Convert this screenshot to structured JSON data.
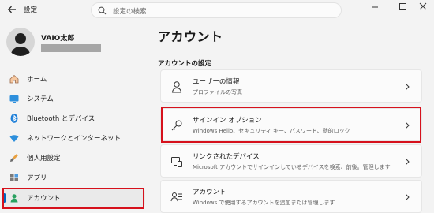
{
  "window": {
    "app_title": "設定",
    "search_placeholder": "設定の検索"
  },
  "user": {
    "name": "VAIO太郎"
  },
  "sidebar": {
    "items": [
      {
        "label": "ホーム",
        "icon": "home-icon"
      },
      {
        "label": "システム",
        "icon": "system-icon"
      },
      {
        "label": "Bluetooth とデバイス",
        "icon": "bluetooth-icon"
      },
      {
        "label": "ネットワークとインターネット",
        "icon": "wifi-icon"
      },
      {
        "label": "個人用設定",
        "icon": "brush-icon"
      },
      {
        "label": "アプリ",
        "icon": "apps-icon"
      },
      {
        "label": "アカウント",
        "icon": "account-icon",
        "selected": true
      }
    ]
  },
  "main": {
    "title": "アカウント",
    "section_title": "アカウントの設定",
    "cards": [
      {
        "title": "ユーザーの情報",
        "subtitle": "プロファイルの写真",
        "icon": "person-icon"
      },
      {
        "title": "サインイン オプション",
        "subtitle": "Windows Hello、セキュリティ キー、パスワード、動的ロック",
        "icon": "key-icon"
      },
      {
        "title": "リンクされたデバイス",
        "subtitle": "Microsoft アカウントでサインインしているデバイスを検索、前後。管理します",
        "icon": "devices-icon"
      },
      {
        "title": "アカウント",
        "subtitle": "Windows で使用するアカウントを追加または管理します",
        "icon": "accounts-list-icon"
      }
    ]
  },
  "colors": {
    "accent": "#0067c0",
    "highlight": "#d6111c"
  }
}
